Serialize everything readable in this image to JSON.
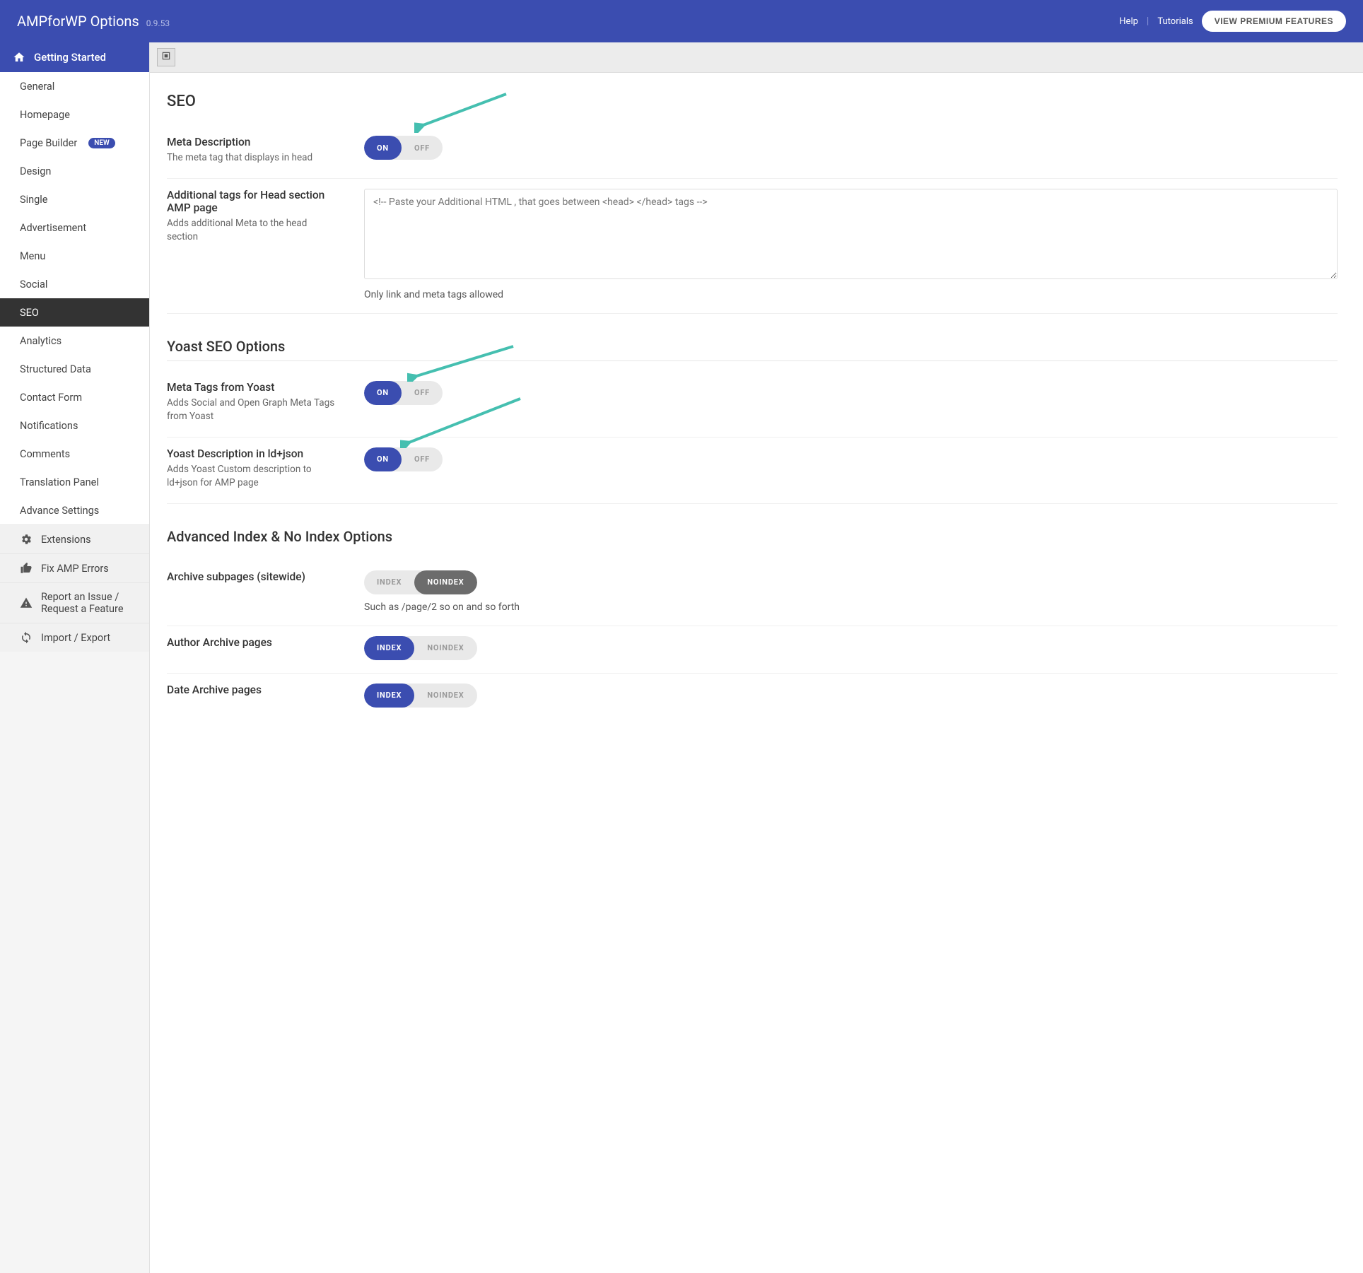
{
  "header": {
    "title": "AMPforWP Options",
    "version": "0.9.53",
    "help": "Help",
    "tutorials": "Tutorials",
    "premium": "VIEW PREMIUM FEATURES"
  },
  "sidebar": {
    "top": "Getting Started",
    "items": [
      "General",
      "Homepage",
      "Page Builder",
      "Design",
      "Single",
      "Advertisement",
      "Menu",
      "Social",
      "SEO",
      "Analytics",
      "Structured Data",
      "Contact Form",
      "Notifications",
      "Comments",
      "Translation Panel",
      "Advance Settings"
    ],
    "badge_item": "Page Builder",
    "badge": "NEW",
    "active": "SEO",
    "gray": [
      "Extensions",
      "Fix AMP Errors",
      "Report an Issue / Request a Feature",
      "Import / Export"
    ]
  },
  "page": {
    "title": "SEO",
    "yoast_section": "Yoast SEO Options",
    "advanced_section": "Advanced Index & No Index Options"
  },
  "opt": {
    "meta_desc": {
      "title": "Meta Description",
      "desc": "The meta tag that displays in head"
    },
    "head_tags": {
      "title": "Additional tags for Head section AMP page",
      "desc": "Adds additional Meta to the head section",
      "placeholder": "<!-- Paste your Additional HTML , that goes between <head> </head> tags -->",
      "hint": "Only link and meta tags allowed"
    },
    "yoast_meta": {
      "title": "Meta Tags from Yoast",
      "desc": "Adds Social and Open Graph Meta Tags from Yoast"
    },
    "yoast_desc": {
      "title": "Yoast Description in ld+json",
      "desc": "Adds Yoast Custom description to ld+json for AMP page"
    },
    "archive_sub": {
      "title": "Archive subpages (sitewide)",
      "hint": "Such as /page/2 so on and so forth"
    },
    "author_arch": {
      "title": "Author Archive pages"
    },
    "date_arch": {
      "title": "Date Archive pages"
    }
  },
  "toggle": {
    "on": "ON",
    "off": "OFF",
    "index": "INDEX",
    "noindex": "NOINDEX"
  }
}
